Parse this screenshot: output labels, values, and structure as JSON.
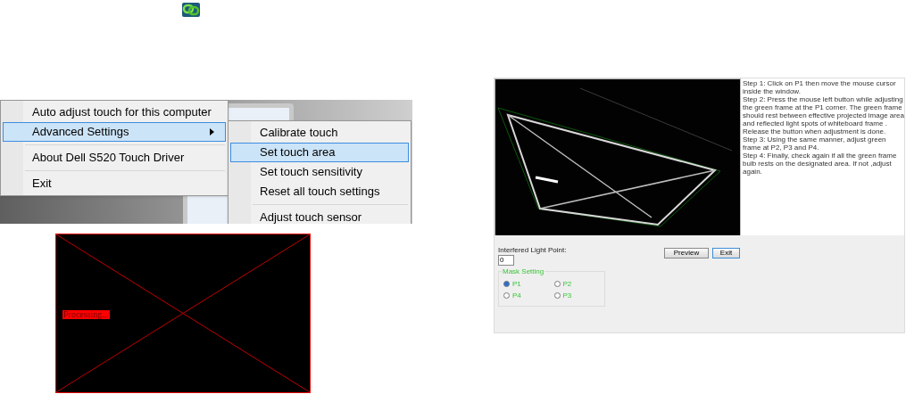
{
  "tray_menu": {
    "items": [
      {
        "label": "Auto adjust touch for this computer",
        "selected": false,
        "submenu": false,
        "divider_above": false
      },
      {
        "label": "Advanced Settings",
        "selected": true,
        "submenu": true,
        "divider_above": false
      },
      {
        "label": "About Dell S520 Touch Driver",
        "selected": false,
        "submenu": false,
        "divider_above": true
      },
      {
        "label": "Exit",
        "selected": false,
        "submenu": false,
        "divider_above": true
      }
    ]
  },
  "submenu": {
    "items": [
      {
        "label": "Calibrate touch",
        "selected": false,
        "divider_above": false
      },
      {
        "label": "Set touch area",
        "selected": true,
        "divider_above": false
      },
      {
        "label": "Set touch sensitivity",
        "selected": false,
        "divider_above": false
      },
      {
        "label": "Reset all touch settings",
        "selected": false,
        "divider_above": false
      },
      {
        "label": "Adjust touch sensor",
        "selected": false,
        "divider_above": true
      }
    ]
  },
  "processing_view": {
    "status": "Processing..."
  },
  "touch_area_window": {
    "instructions": [
      "Step 1: Click on P1 then move the mouse cursor inside the window.",
      "Step 2: Press the mouse left button while adjusting the green frame at the P1 corner. The green frame should rest between effective projected image area and reflected light spots of whiteboard frame . Release the button when adjustment is done.",
      "Step 3: Using the same manner, adjust green frame at P2, P3 and P4.",
      "Step 4: Finally, check again if all the green frame bulb rests on the designated area. If not ,adjust again."
    ],
    "interfered_label": "Interfered Light Point:",
    "interfered_value": "0",
    "mask_group": "Mask Setting",
    "mask_points": [
      {
        "label": "P1",
        "selected": true
      },
      {
        "label": "P2",
        "selected": false
      },
      {
        "label": "P4",
        "selected": false
      },
      {
        "label": "P3",
        "selected": false
      }
    ],
    "buttons": [
      "Preview",
      "Exit"
    ]
  }
}
